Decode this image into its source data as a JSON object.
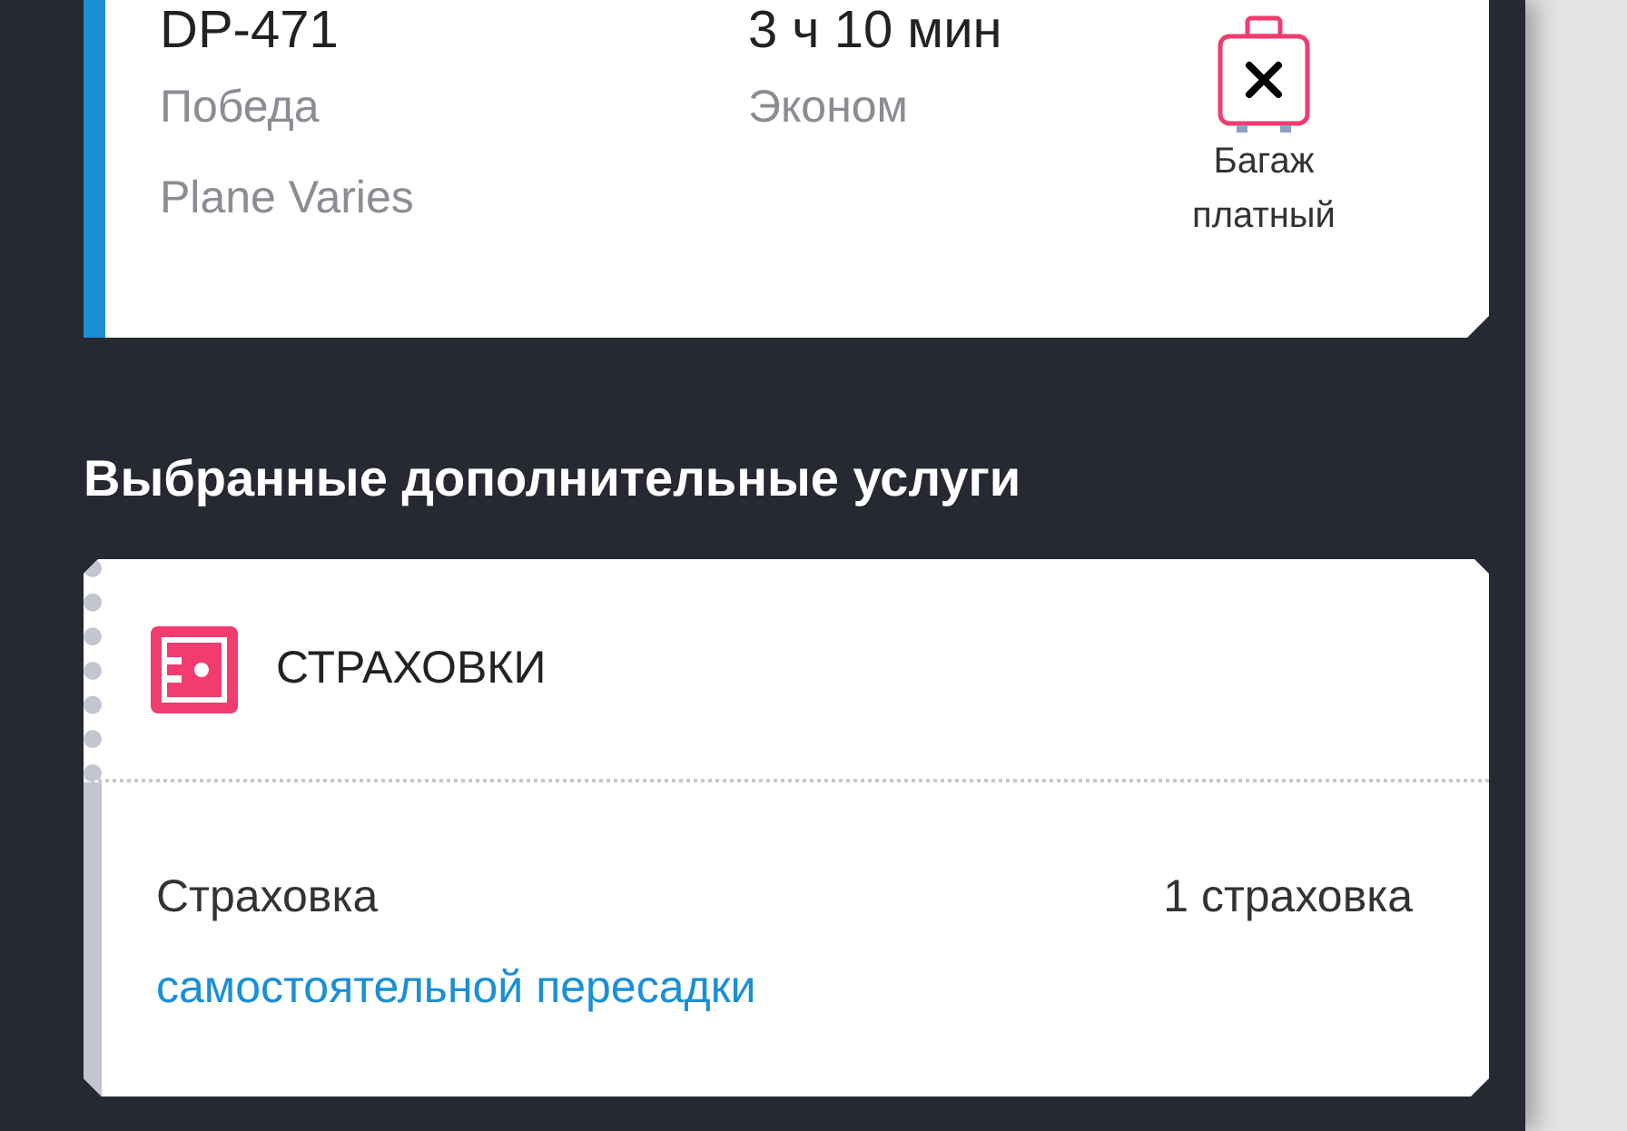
{
  "flight": {
    "number": "DP-471",
    "airline": "Победа",
    "aircraft": "Plane Varies",
    "duration": "3 ч 10 мин",
    "cabin": "Эконом",
    "baggage": {
      "label": "Багаж платный",
      "paid": true
    }
  },
  "services_heading": "Выбранные дополнительные услуги",
  "services": [
    {
      "title": "СТРАХОВКИ",
      "items": [
        {
          "prefix": "Страховка",
          "link": "самостоятельной пересадки",
          "count": "1 страховка"
        }
      ]
    }
  ]
}
